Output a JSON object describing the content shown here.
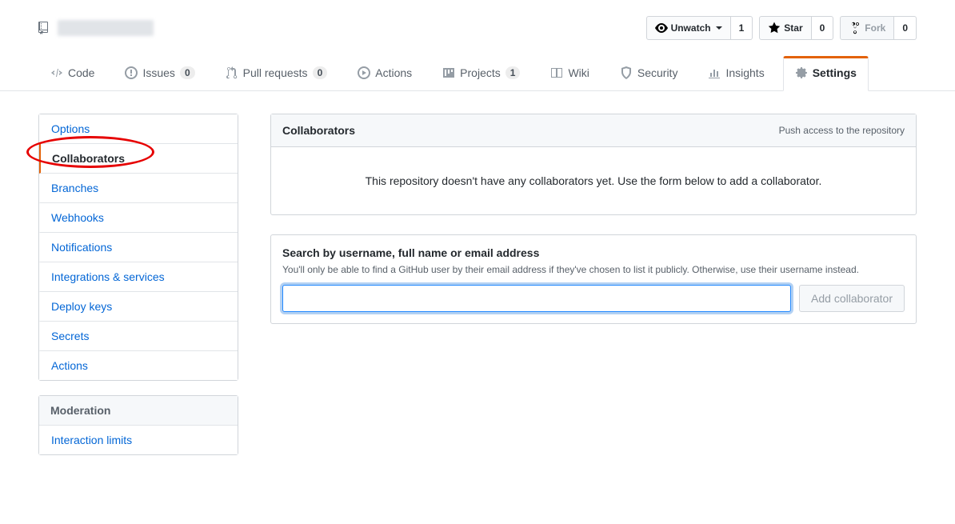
{
  "repo": {
    "blurred_name": "",
    "watch_label": "Unwatch",
    "watch_count": "1",
    "star_label": "Star",
    "star_count": "0",
    "fork_label": "Fork",
    "fork_count": "0"
  },
  "tabs": {
    "code": "Code",
    "issues": "Issues",
    "issues_count": "0",
    "pulls": "Pull requests",
    "pulls_count": "0",
    "actions": "Actions",
    "projects": "Projects",
    "projects_count": "1",
    "wiki": "Wiki",
    "security": "Security",
    "insights": "Insights",
    "settings": "Settings"
  },
  "sidebar": {
    "items": [
      {
        "label": "Options"
      },
      {
        "label": "Collaborators"
      },
      {
        "label": "Branches"
      },
      {
        "label": "Webhooks"
      },
      {
        "label": "Notifications"
      },
      {
        "label": "Integrations & services"
      },
      {
        "label": "Deploy keys"
      },
      {
        "label": "Secrets"
      },
      {
        "label": "Actions"
      }
    ],
    "moderation_header": "Moderation",
    "moderation_items": [
      {
        "label": "Interaction limits"
      }
    ]
  },
  "panel": {
    "title": "Collaborators",
    "subtitle": "Push access to the repository",
    "empty_message": "This repository doesn't have any collaborators yet. Use the form below to add a collaborator."
  },
  "search": {
    "heading": "Search by username, full name or email address",
    "hint": "You'll only be able to find a GitHub user by their email address if they've chosen to list it publicly. Otherwise, use their username instead.",
    "value": "",
    "button": "Add collaborator"
  }
}
